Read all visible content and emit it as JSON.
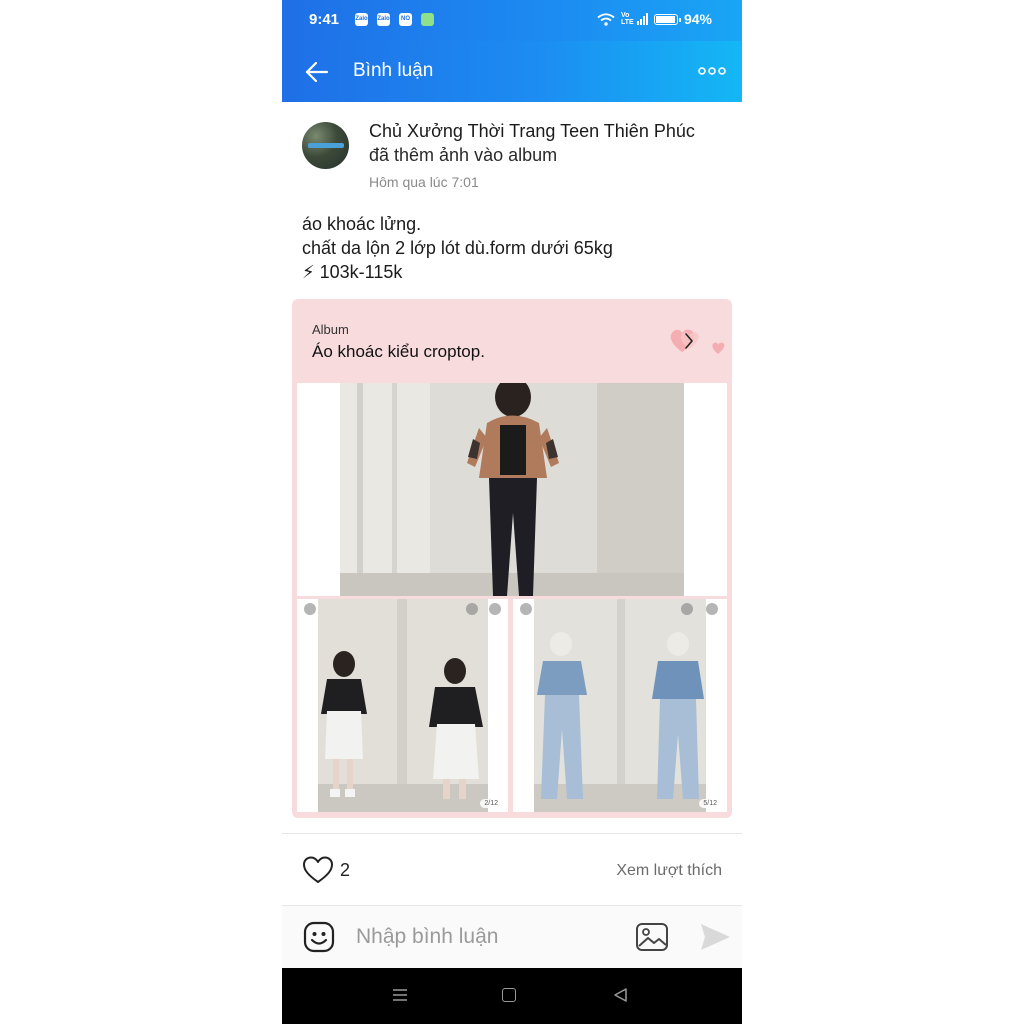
{
  "status_bar": {
    "time": "9:41",
    "notification_icons": [
      "Zalo",
      "Zalo",
      "NO",
      "wallet"
    ],
    "network": "Vo LTE",
    "battery": "94%"
  },
  "app_bar": {
    "title": "Bình luận",
    "back_icon": "arrow-left-icon",
    "more_icon": "more-dots-icon"
  },
  "post": {
    "author": "Chủ Xưởng Thời Trang Teen Thiên Phúc",
    "action": "đã thêm ảnh vào album",
    "time": "Hôm qua lúc 7:01",
    "caption_lines": [
      "áo khoác lửng.",
      "chất da lộn 2 lớp lót dù.form dưới 65kg",
      "⚡ 103k-115k"
    ],
    "album": {
      "kicker": "Album",
      "title": "Áo khoác kiểu croptop.",
      "photo_counters": [
        "2/12",
        "5/12"
      ]
    }
  },
  "reactions": {
    "like_count": "2",
    "view_likes_label": "Xem lượt thích"
  },
  "comment_bar": {
    "placeholder": "Nhập bình luận"
  },
  "colors": {
    "header_start": "#1f6fe6",
    "header_end": "#14b7f5",
    "album_bg": "#f8dcdd"
  }
}
